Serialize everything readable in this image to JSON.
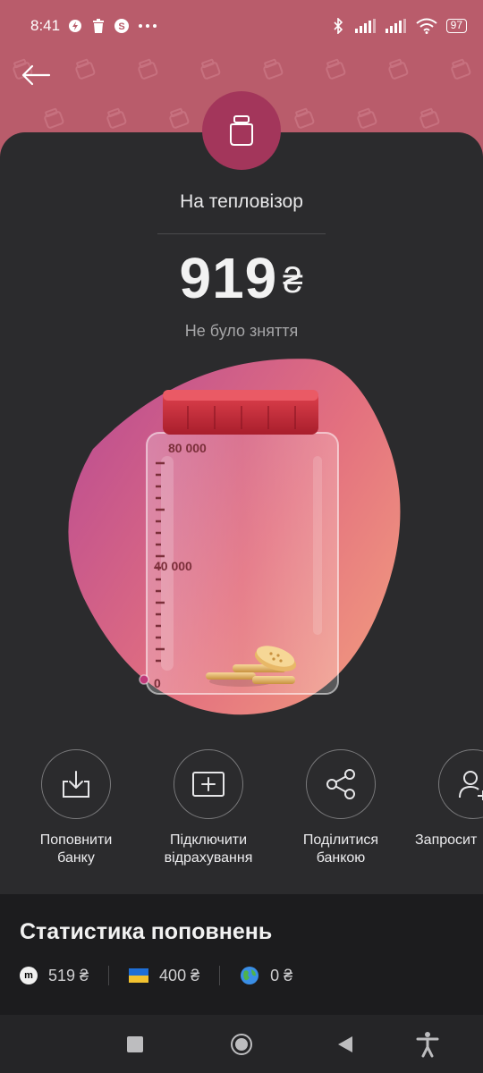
{
  "status_bar": {
    "time": "8:41",
    "battery": "97",
    "icons": [
      "power-saver-icon",
      "trash-icon",
      "s-app-icon",
      "more-dots-icon",
      "bluetooth-icon",
      "signal-icon",
      "signal-icon",
      "wifi-icon",
      "battery-icon"
    ]
  },
  "header": {
    "back_icon": "arrow-left-icon",
    "badge_icon": "jar-icon"
  },
  "jar": {
    "title": "На тепловізор",
    "amount": "919",
    "currency": "₴",
    "subtitle": "Не було зняття",
    "scale_top": "80 000",
    "scale_mid": "40 000",
    "scale_zero": "0"
  },
  "actions": [
    {
      "label_line1": "Поповнити",
      "label_line2": "банку",
      "icon": "top-up-icon"
    },
    {
      "label_line1": "Підключити",
      "label_line2": "відрахування",
      "icon": "add-card-icon"
    },
    {
      "label_line1": "Поділитися",
      "label_line2": "банкою",
      "icon": "share-icon"
    },
    {
      "label_line1": "Запросит",
      "label_line2": "",
      "icon": "add-user-icon"
    }
  ],
  "stats": {
    "title": "Статистика поповнень",
    "items": [
      {
        "icon": "m",
        "value": "519 ₴"
      },
      {
        "icon": "ukraine-flag-icon",
        "value": "400 ₴"
      },
      {
        "icon": "globe-icon",
        "value": "0 ₴"
      }
    ]
  },
  "colors": {
    "header": "#b95c6b",
    "accent": "#a3365b",
    "sheet": "#2b2b2d",
    "background": "#1c1c1e"
  }
}
